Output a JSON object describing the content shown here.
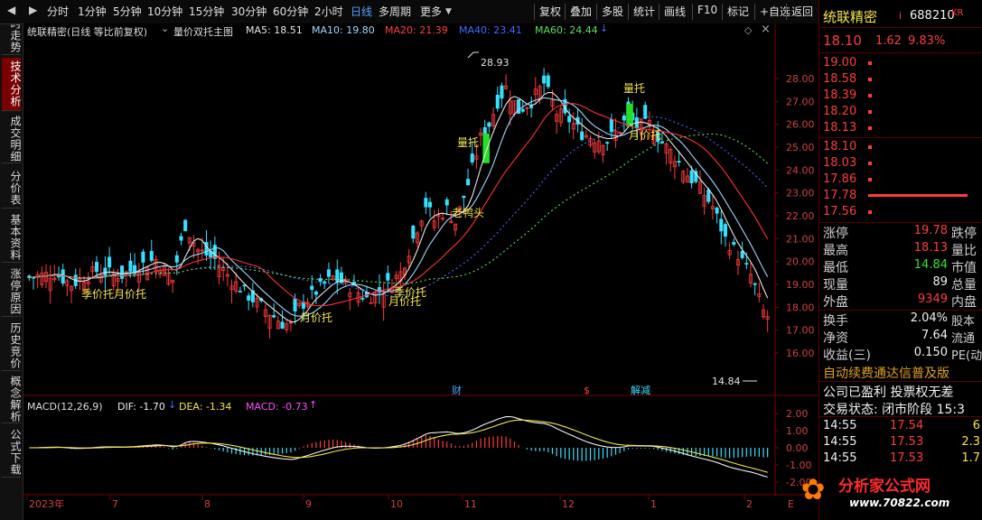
{
  "toolbar": {
    "left_icons": [
      "back-icon",
      "forward-icon"
    ],
    "periods": [
      "分时",
      "1分钟",
      "5分钟",
      "10分钟",
      "15分钟",
      "30分钟",
      "60分钟",
      "2小时",
      "日线",
      "多周期",
      "更多"
    ],
    "active_period": "日线",
    "right_buttons": [
      "复权",
      "叠加",
      "多股",
      "统计",
      "画线",
      "F10",
      "标记",
      "+自选",
      "返回"
    ]
  },
  "left_tabs": [
    "分时走势",
    "技术分析",
    "成交明细",
    "分价表",
    "基本资料",
    "涨停原因",
    "历史竞价",
    "概念解析",
    "公式下载"
  ],
  "active_left_tab": "技术分析",
  "chart_header": {
    "title": "统联精密(日线 等比前复权)",
    "indicator": "量价双托主图",
    "ma5": "MA5: 18.51",
    "ma10": "MA10: 19.80",
    "ma20": "MA20: 21.39",
    "ma40": "MA40: 23.41",
    "ma60": "MA60: 24.44"
  },
  "main_chart": {
    "y_ticks": [
      "28.00",
      "27.00",
      "26.00",
      "25.00",
      "24.00",
      "23.00",
      "22.00",
      "21.00",
      "20.00",
      "19.00",
      "18.00",
      "17.00",
      "16.00"
    ],
    "high_label": "28.93",
    "low_label": "14.84",
    "annotations": [
      "季价托",
      "月价托",
      "月价托",
      "季价托",
      "月价托",
      "量托",
      "老鸭头",
      "量托",
      "月价托"
    ],
    "event_marks": [
      "财",
      "$",
      "解减"
    ]
  },
  "macd": {
    "title": "MACD(12,26,9)",
    "dif": "DIF: -1.70",
    "dea": "DEA: -1.34",
    "macd": "MACD: -0.73",
    "y_ticks": [
      "2.00",
      "1.00",
      "0.00",
      "-1.00",
      "-2.00"
    ]
  },
  "x_axis": [
    "2023年",
    "7",
    "8",
    "9",
    "10",
    "11",
    "12",
    "1",
    "2"
  ],
  "x_axis_extra": "E",
  "quote": {
    "name": "统联精密",
    "code": "688210",
    "market": "KR",
    "price": "18.10",
    "change": "1.62",
    "change_pct": "9.83%",
    "asks": [
      "19.00",
      "18.58",
      "18.39",
      "18.20",
      "18.13"
    ],
    "bids": [
      "18.10",
      "18.03",
      "17.86",
      "17.78",
      "17.56"
    ],
    "stats": [
      {
        "l1": "涨停",
        "v1": "19.78",
        "l2": "跌停",
        "c": "red"
      },
      {
        "l1": "最高",
        "v1": "18.13",
        "l2": "量比",
        "c": "red"
      },
      {
        "l1": "最低",
        "v1": "14.84",
        "l2": "市值",
        "c": "green"
      },
      {
        "l1": "现量",
        "v1": "89",
        "l2": "总量",
        "c": "white"
      },
      {
        "l1": "外盘",
        "v1": "9349",
        "l2": "内盘",
        "c": "red"
      }
    ],
    "stats2": [
      {
        "l1": "换手",
        "v1": "2.04%",
        "l2": "股本"
      },
      {
        "l1": "净资",
        "v1": "7.64",
        "l2": "流通"
      },
      {
        "l1": "收益(三)",
        "v1": "0.150",
        "l2": "PE(动)"
      }
    ],
    "notice": "自动续费通达信普及版",
    "info1": "公司已盈利 投票权无差",
    "info2": "交易状态: 闭市阶段 15:3",
    "ticks": [
      {
        "t": "14:55",
        "p": "17.54",
        "v": "6"
      },
      {
        "t": "14:55",
        "p": "17.53",
        "v": "2.3"
      },
      {
        "t": "14:55",
        "p": "17.53",
        "v": "1.7"
      }
    ]
  },
  "watermark": {
    "name": "分析家公式网",
    "url": "www.70822.com"
  }
}
